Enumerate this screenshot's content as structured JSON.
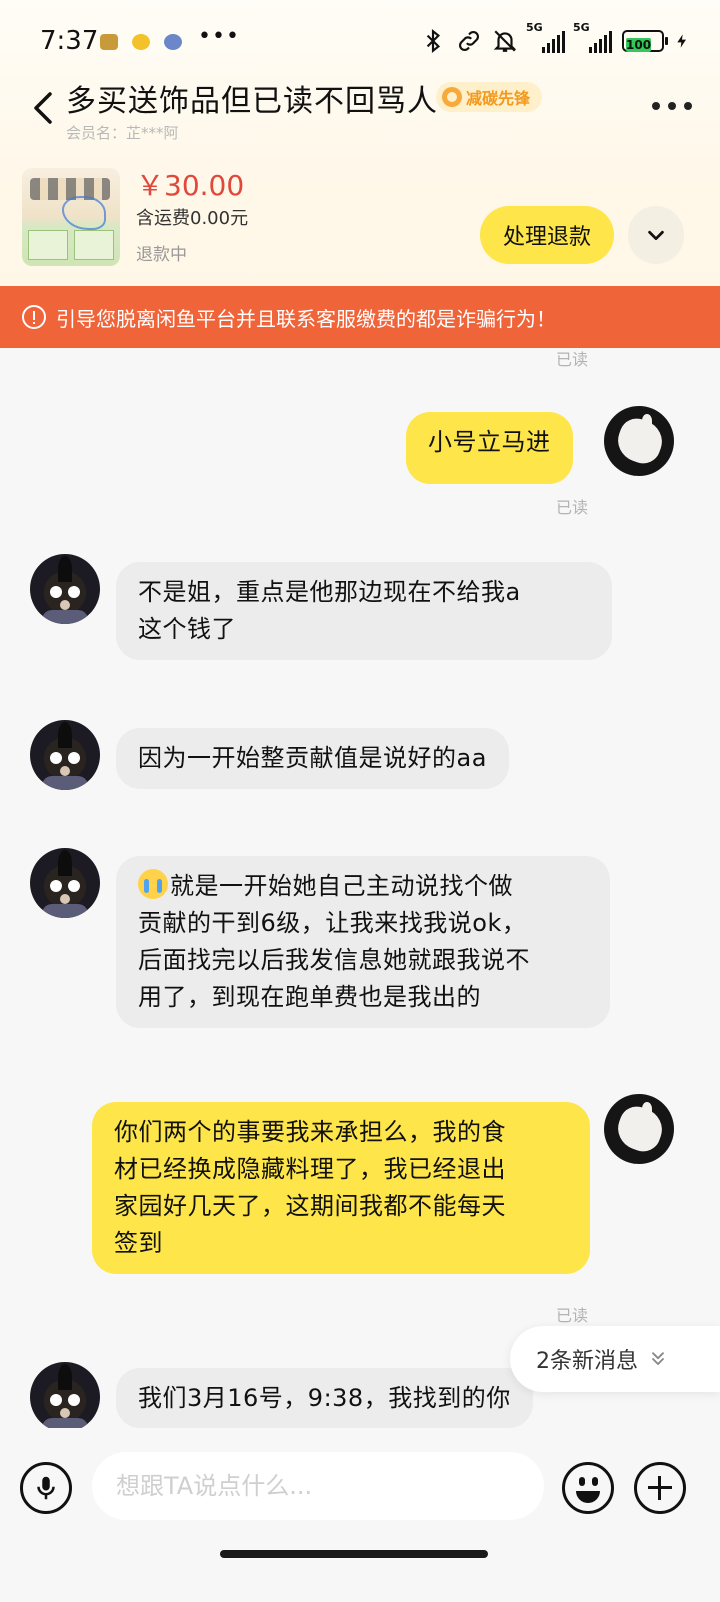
{
  "status_bar": {
    "time": "7:37",
    "dots": "•••",
    "battery": "100",
    "net1": "5G",
    "net2": "5G"
  },
  "header": {
    "title": "多买送饰品但已读不回骂人",
    "badge": "减碳先锋",
    "member": "会员名：芷***阿"
  },
  "product": {
    "price": "￥30.00",
    "shipping": "含运费0.00元",
    "status": "退款中",
    "action": "处理退款"
  },
  "warning": "引导您脱离闲鱼平台并且联系客服缴费的都是诈骗行为！",
  "messages": {
    "read_label": "已读",
    "m1": "小号立马进",
    "m2_l1": "不是姐，重点是他那边现在不给我a",
    "m2_l2": "这个钱了",
    "m3": "因为一开始整贡献值是说好的aa",
    "m4_l1": "就是一开始她自己主动说找个做",
    "m4_l2": "贡献的干到6级，让我来找我说ok，",
    "m4_l3": "后面找完以后我发信息她就跟我说不",
    "m4_l4": "用了，到现在跑单费也是我出的",
    "m5_l1": "你们两个的事要我来承担么，我的食",
    "m5_l2": "材已经换成隐藏料理了，我已经退出",
    "m5_l3": "家园好几天了，这期间我都不能每天",
    "m5_l4": "签到",
    "m6": "我们3月16号，9:38，我找到的你"
  },
  "new_messages": "2条新消息",
  "input": {
    "placeholder": "想跟TA说点什么..."
  },
  "colors": {
    "accent_yellow": "#fde54a",
    "warning_orange": "#f0643a",
    "price_red": "#e0483b"
  }
}
